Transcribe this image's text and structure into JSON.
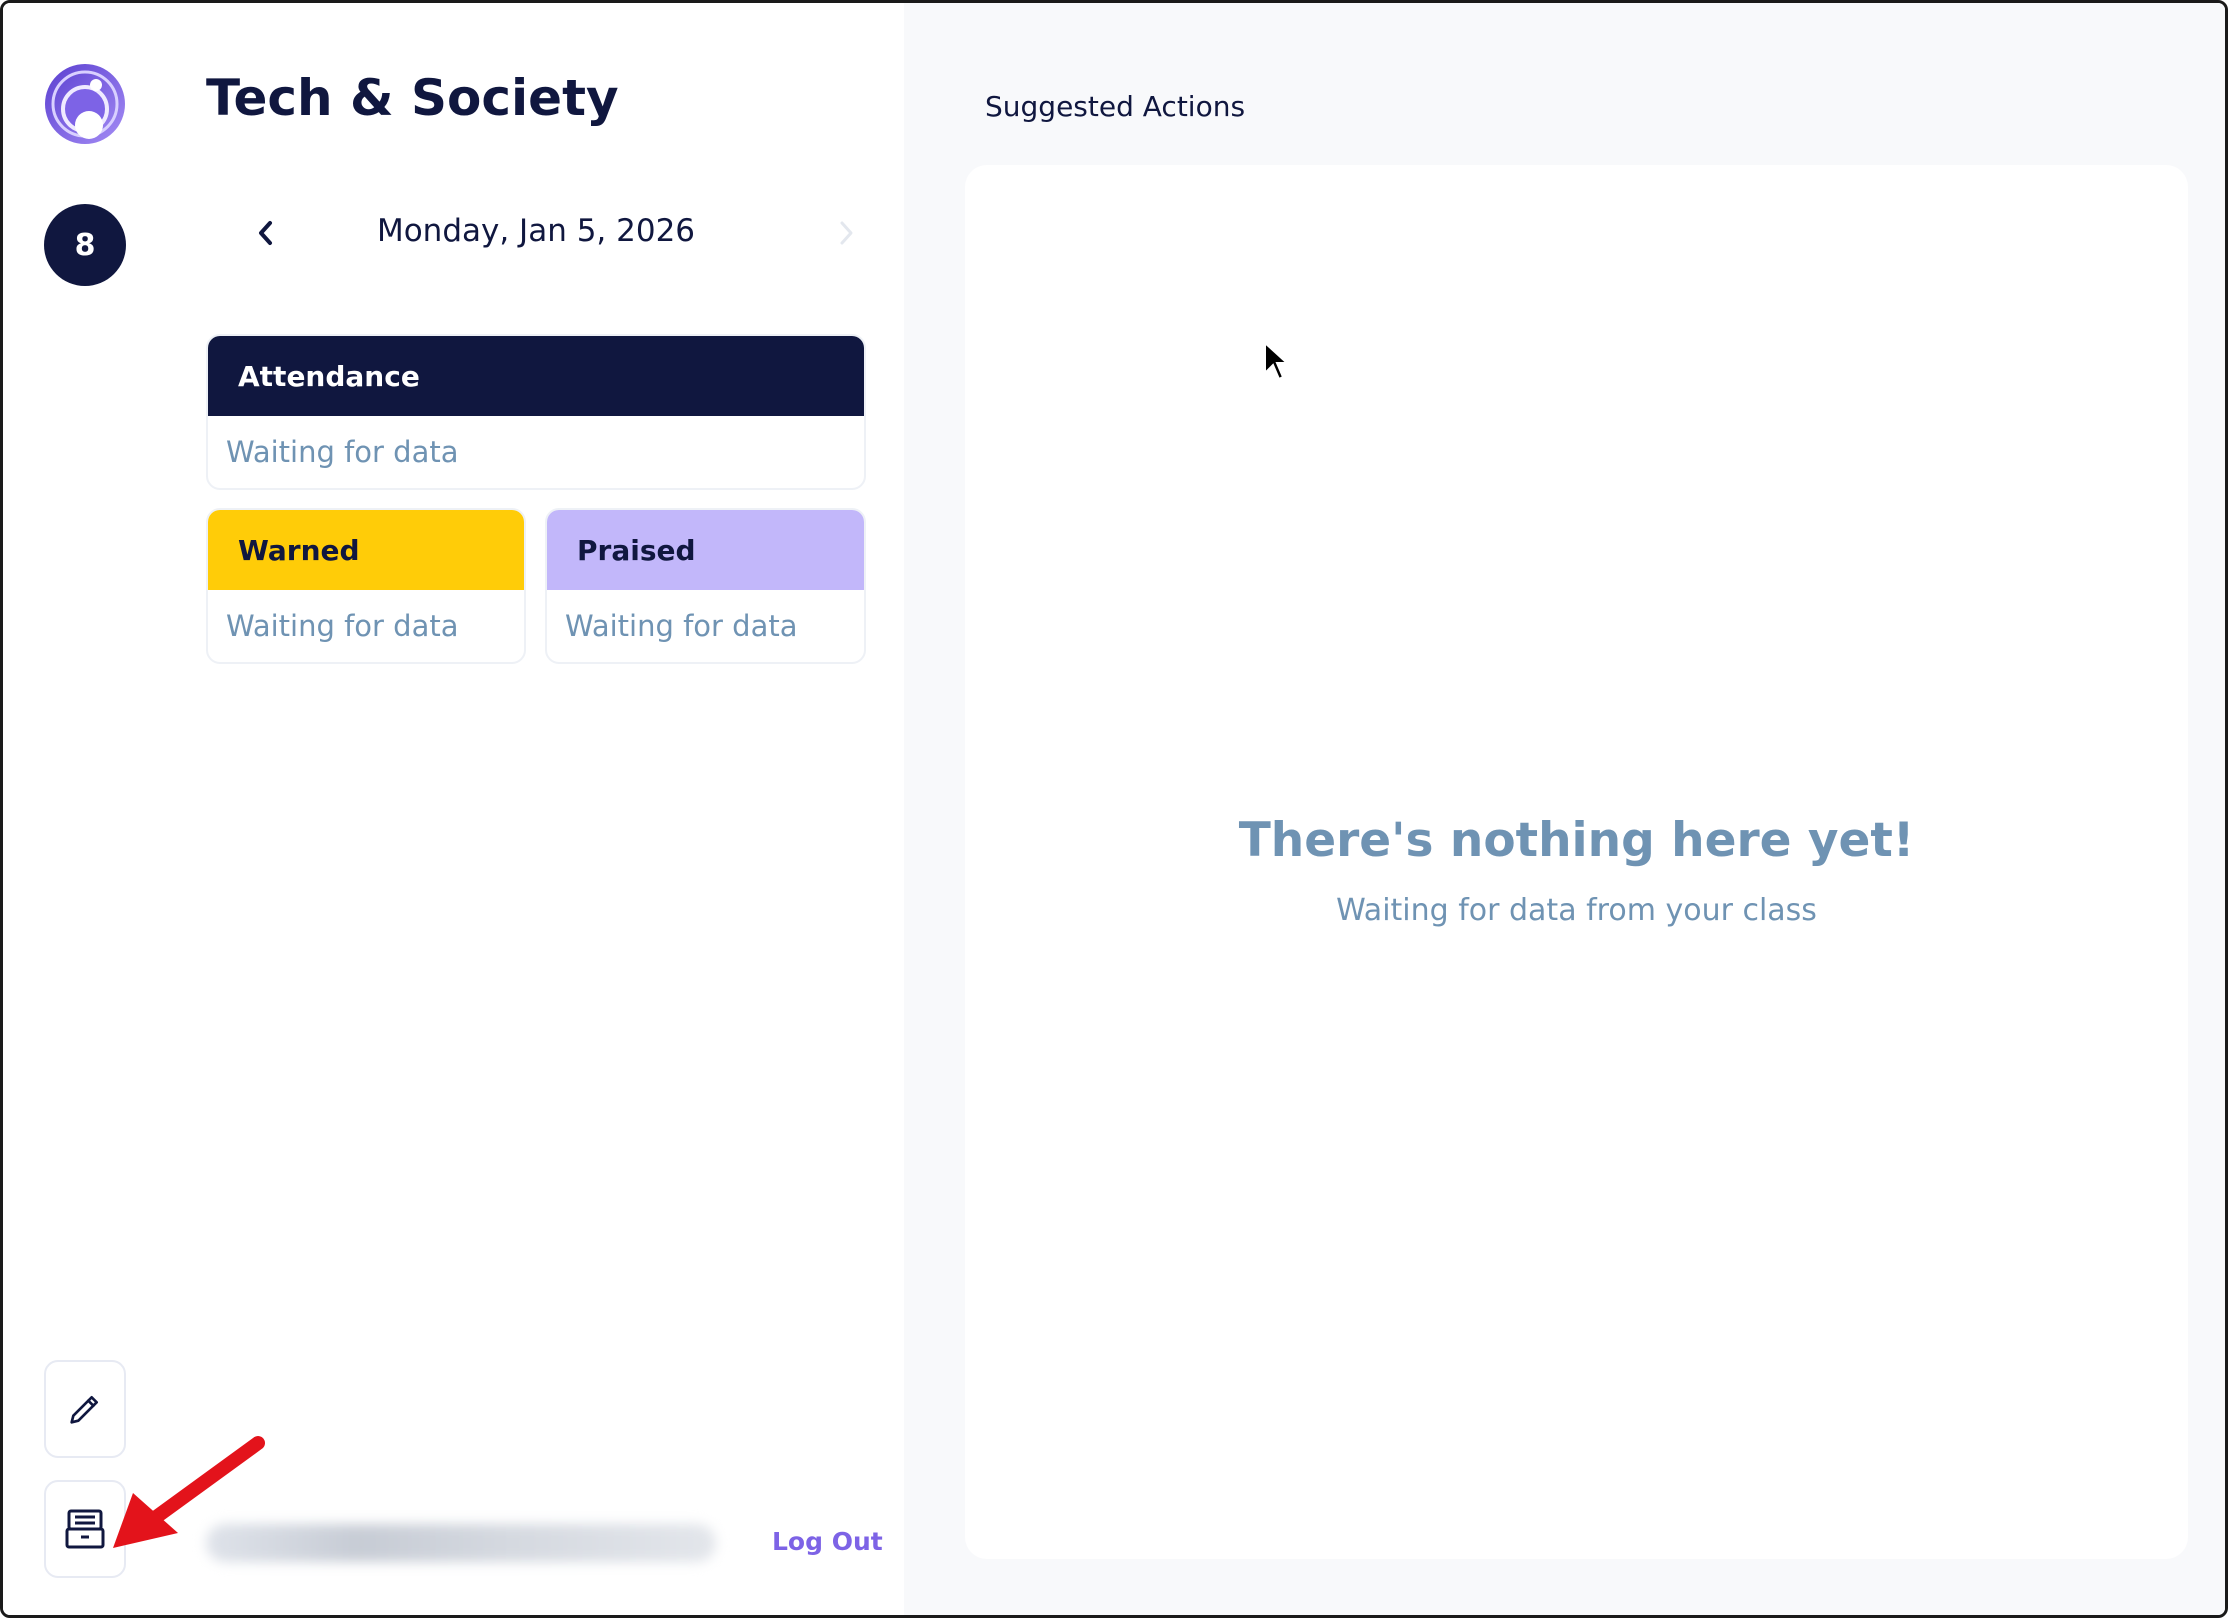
{
  "sidebar": {
    "class_badge": "8",
    "edit_icon": "pencil-icon",
    "archive_icon": "archive-icon"
  },
  "class_panel": {
    "title": "Tech & Society",
    "date": "Monday, Jan 5, 2026",
    "cards": {
      "attendance": {
        "label": "Attendance",
        "status": "Waiting for data"
      },
      "warned": {
        "label": "Warned",
        "status": "Waiting for data"
      },
      "praised": {
        "label": "Praised",
        "status": "Waiting for data"
      }
    },
    "logout_label": "Log Out"
  },
  "actions_panel": {
    "title": "Suggested Actions",
    "empty_title": "There's nothing here yet!",
    "empty_subtitle": "Waiting for data from your class"
  },
  "colors": {
    "navy": "#10173f",
    "warned": "#ffcc08",
    "praised": "#c2b7fa",
    "muted_text": "#6f93b3",
    "logout": "#7d63e6",
    "annotation_red": "#e3131b"
  }
}
